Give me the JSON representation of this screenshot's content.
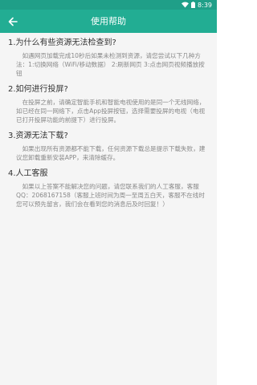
{
  "status_bar": {
    "time": "8:39"
  },
  "app_bar": {
    "title": "使用帮助",
    "back_icon": "arrow-left"
  },
  "colors": {
    "status_bar": "#1f9f88",
    "app_bar": "#22ad93",
    "background": "#f5f5f5",
    "title_text": "#333333",
    "body_text": "#888888"
  },
  "sections": [
    {
      "title": "1.为什么有些资源无法检查到?",
      "body": "如遇网页加载完成10秒后如果未检测到资源，请您尝试以下几种方法：1:切换网络（WiFi/移动数据） 2:刷新网页 3:点击网页视频播放按钮"
    },
    {
      "title": "2.如何进行投屏?",
      "body": "在投屏之前，请确定智能手机和智能电视使用的是同一个无线网络，如已经在同一网络下，点击App投屏按钮，选择需要投屏的电视（电视已打开投屏功能的前提下）进行投屏。"
    },
    {
      "title": "3.资源无法下载?",
      "body": "如果出现所有资源都不能下载，任何资源下载总是提示下载失败，建议您卸载重新安装APP，来清除缓存。"
    },
    {
      "title": "4.人工客服",
      "body": "如果以上答案不能解决您的问题，请您联系我们的人工客服，客服QQ：2068167158（客服上班时间为周一至周五白天，客服不在线时您可以预先留言，我们会在看到您的消息后及时回复！）"
    }
  ]
}
